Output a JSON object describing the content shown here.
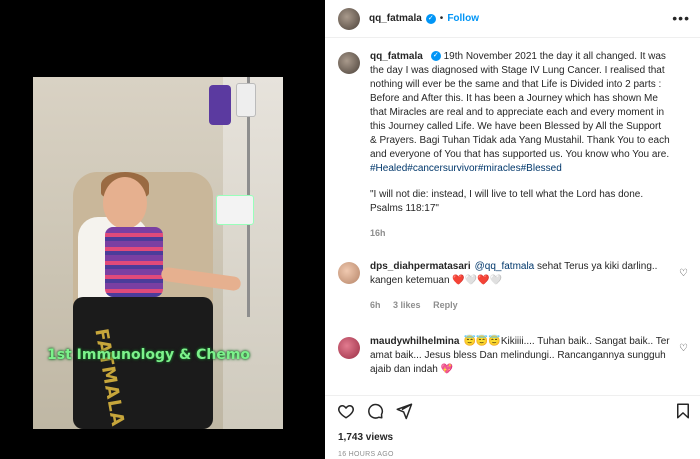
{
  "post": {
    "username": "qq_fatmala",
    "follow_label": "Follow",
    "photo_caption": "1st Immunology & Chemo",
    "pants_text": "FATMALA"
  },
  "caption": {
    "username": "qq_fatmala",
    "text": "19th November 2021 the day it all changed. It was the day I was diagnosed with Stage IV Lung Cancer. I realised that nothing will ever be the same and that Life is Divided into 2 parts : Before and After this. It has been a Journey which has shown Me that Miracles are real and to appreciate each and every moment in this Journey called Life. We have been Blessed by All the Support & Prayers. Bagi Tuhan Tidak ada Yang Mustahil. Thank You to each and everyone of You that has supported us. You know who You are.",
    "hashtags": "#Healed#cancersurvivor#miracles#Blessed",
    "quote": "\"I will not die: instead, I will live to tell what the Lord has done. Psalms 118:17\"",
    "time": "16h"
  },
  "comments": [
    {
      "username": "dps_diahpermatasari",
      "mention": "@qq_fatmala",
      "text": " sehat Terus ya kiki darling.. kangen ketemuan ❤️🤍❤️🤍",
      "time": "6h",
      "likes": "3 likes",
      "reply": "Reply"
    },
    {
      "username": "maudywhilhelmina",
      "text": "😇😇😇Kikiiii.... Tuhan baik.. Sangat baik.. Ter amat baik... Jesus bless Dan melindungi.. Rancangannya sungguh ajaib dan indah 💖"
    }
  ],
  "footer": {
    "views": "1,743 views",
    "ago": "16 HOURS AGO"
  },
  "icons": [
    "heart-icon",
    "comment-icon",
    "share-icon",
    "bookmark-icon",
    "more-icon",
    "verified-icon"
  ],
  "colors": {
    "accent": "#0095f6",
    "text": "#262626",
    "muted": "#8e8e8e",
    "hashtag": "#00376b"
  }
}
